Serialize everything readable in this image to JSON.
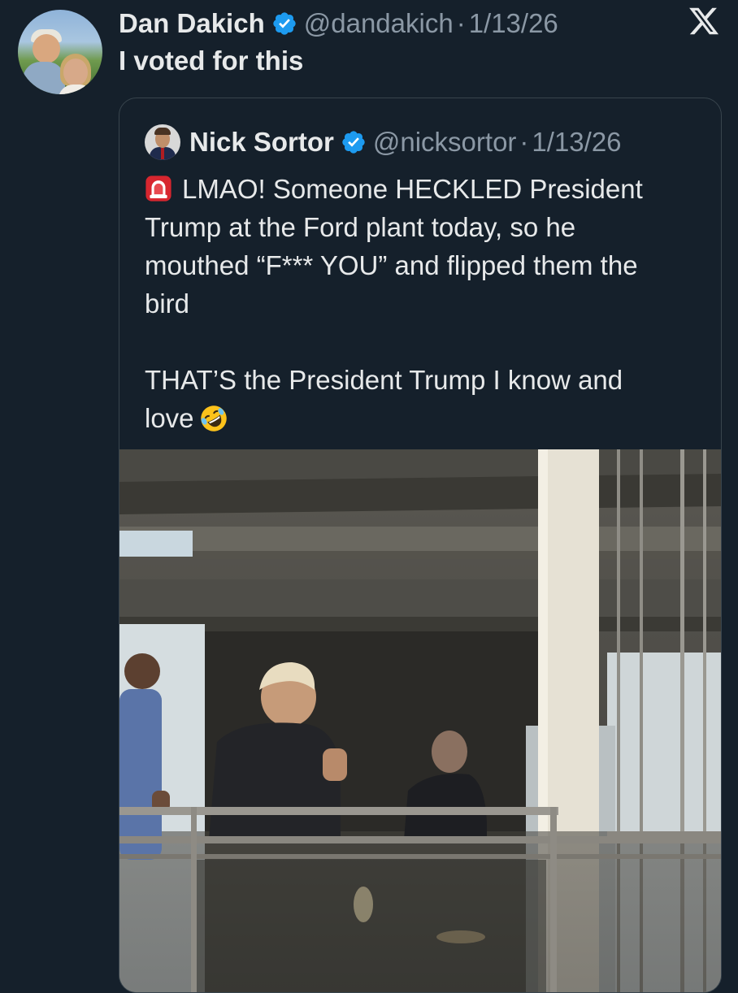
{
  "tweet": {
    "author_name": "Dan Dakich",
    "handle": "@dandakich",
    "separator": "·",
    "date": "1/13/26",
    "text": "I voted for this"
  },
  "quoted_tweet": {
    "author_name": "Nick Sortor",
    "handle": "@nicksortor",
    "separator": "·",
    "date": "1/13/26",
    "lines": [
      "LMAO! Someone HECKLED President",
      "Trump at the Ford plant today, so he",
      "mouthed “F*** YOU” and flipped them the",
      "bird"
    ],
    "lines2": [
      "THAT’S the President Trump I know and",
      "love"
    ],
    "lead_emoji": "siren-icon",
    "end_emoji": "rolling-laughing-icon"
  },
  "icons": {
    "verified": "verified-badge-icon",
    "x_logo": "x-logo-icon"
  },
  "colors": {
    "background": "#15202b",
    "text": "#e7e9ea",
    "secondary": "#8b98a5",
    "verified": "#1d9bf0",
    "border": "#38444d"
  }
}
